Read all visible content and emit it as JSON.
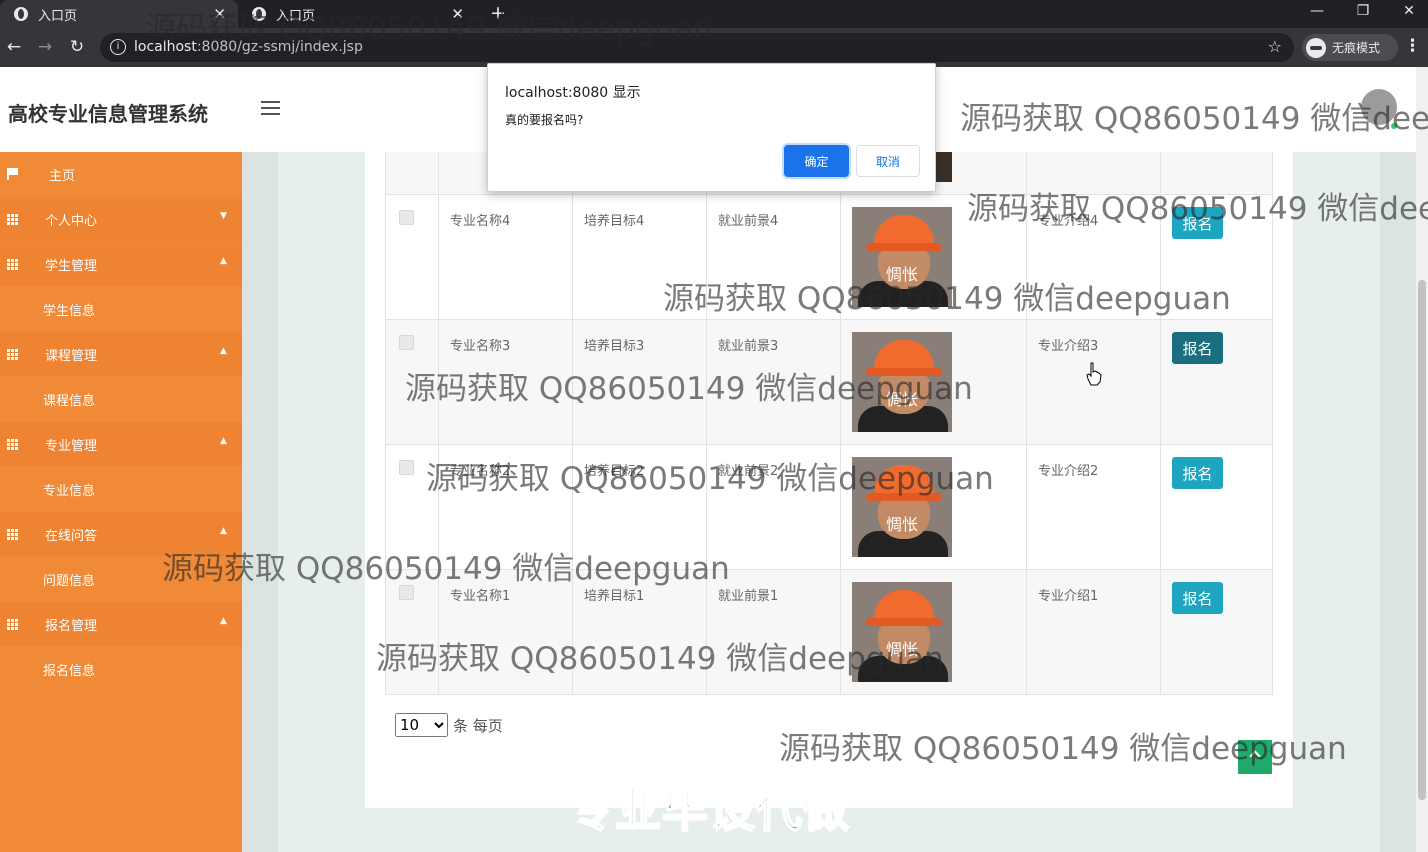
{
  "browser": {
    "tabs": [
      {
        "title": "入口页",
        "active": true
      },
      {
        "title": "入口页",
        "active": false
      }
    ],
    "url_host": "localhost",
    "url_rest": ":8080/gz-ssmj/index.jsp",
    "incognito_label": "无痕模式",
    "icons": {
      "back": "back-arrow-icon",
      "forward": "forward-arrow-icon",
      "reload": "reload-icon",
      "star": "bookmark-star-icon"
    }
  },
  "app": {
    "title": "高校专业信息管理系统"
  },
  "sidebar": {
    "items": [
      {
        "label": "主页",
        "kind": "home"
      },
      {
        "label": "个人中心",
        "kind": "group",
        "caret": "▼"
      },
      {
        "label": "学生管理",
        "kind": "group",
        "caret": "▲"
      },
      {
        "label": "学生信息",
        "kind": "sub"
      },
      {
        "label": "课程管理",
        "kind": "group",
        "caret": "▲"
      },
      {
        "label": "课程信息",
        "kind": "sub"
      },
      {
        "label": "专业管理",
        "kind": "group",
        "caret": "▲"
      },
      {
        "label": "专业信息",
        "kind": "sub"
      },
      {
        "label": "在线问答",
        "kind": "group",
        "caret": "▲"
      },
      {
        "label": "问题信息",
        "kind": "sub"
      },
      {
        "label": "报名管理",
        "kind": "group",
        "caret": "▲"
      },
      {
        "label": "报名信息",
        "kind": "sub"
      }
    ]
  },
  "table": {
    "rows": [
      {
        "name": "专业名称4",
        "goal": "培养目标4",
        "prospect": "就业前景4",
        "intro": "专业介绍4",
        "image_caption": "惆怅",
        "action": "报名"
      },
      {
        "name": "专业名称3",
        "goal": "培养目标3",
        "prospect": "就业前景3",
        "intro": "专业介绍3",
        "image_caption": "惆怅",
        "action": "报名"
      },
      {
        "name": "专业名称2",
        "goal": "培养目标2",
        "prospect": "就业前景2",
        "intro": "专业介绍2",
        "image_caption": "惆怅",
        "action": "报名"
      },
      {
        "name": "专业名称1",
        "goal": "培养目标1",
        "prospect": "就业前景1",
        "intro": "专业介绍1",
        "image_caption": "惆怅",
        "action": "报名"
      }
    ]
  },
  "pager": {
    "page_size": "10",
    "suffix": "条 每页"
  },
  "dialog": {
    "title": "localhost:8080 显示",
    "message": "真的要报名吗?",
    "ok": "确定",
    "cancel": "取消"
  },
  "watermarks": {
    "text": "源码获取 QQ86050149 微信deepguan",
    "text_truncated": "源码获取 QQ86050149 微信deepg",
    "text_truncated2": "源码获取 QQ86050149 微信deep",
    "banner": "专业毕设代做"
  },
  "colors": {
    "sidebar": "#f08a36",
    "signup_button": "#1ea5c0",
    "dialog_ok": "#1a73e8"
  }
}
